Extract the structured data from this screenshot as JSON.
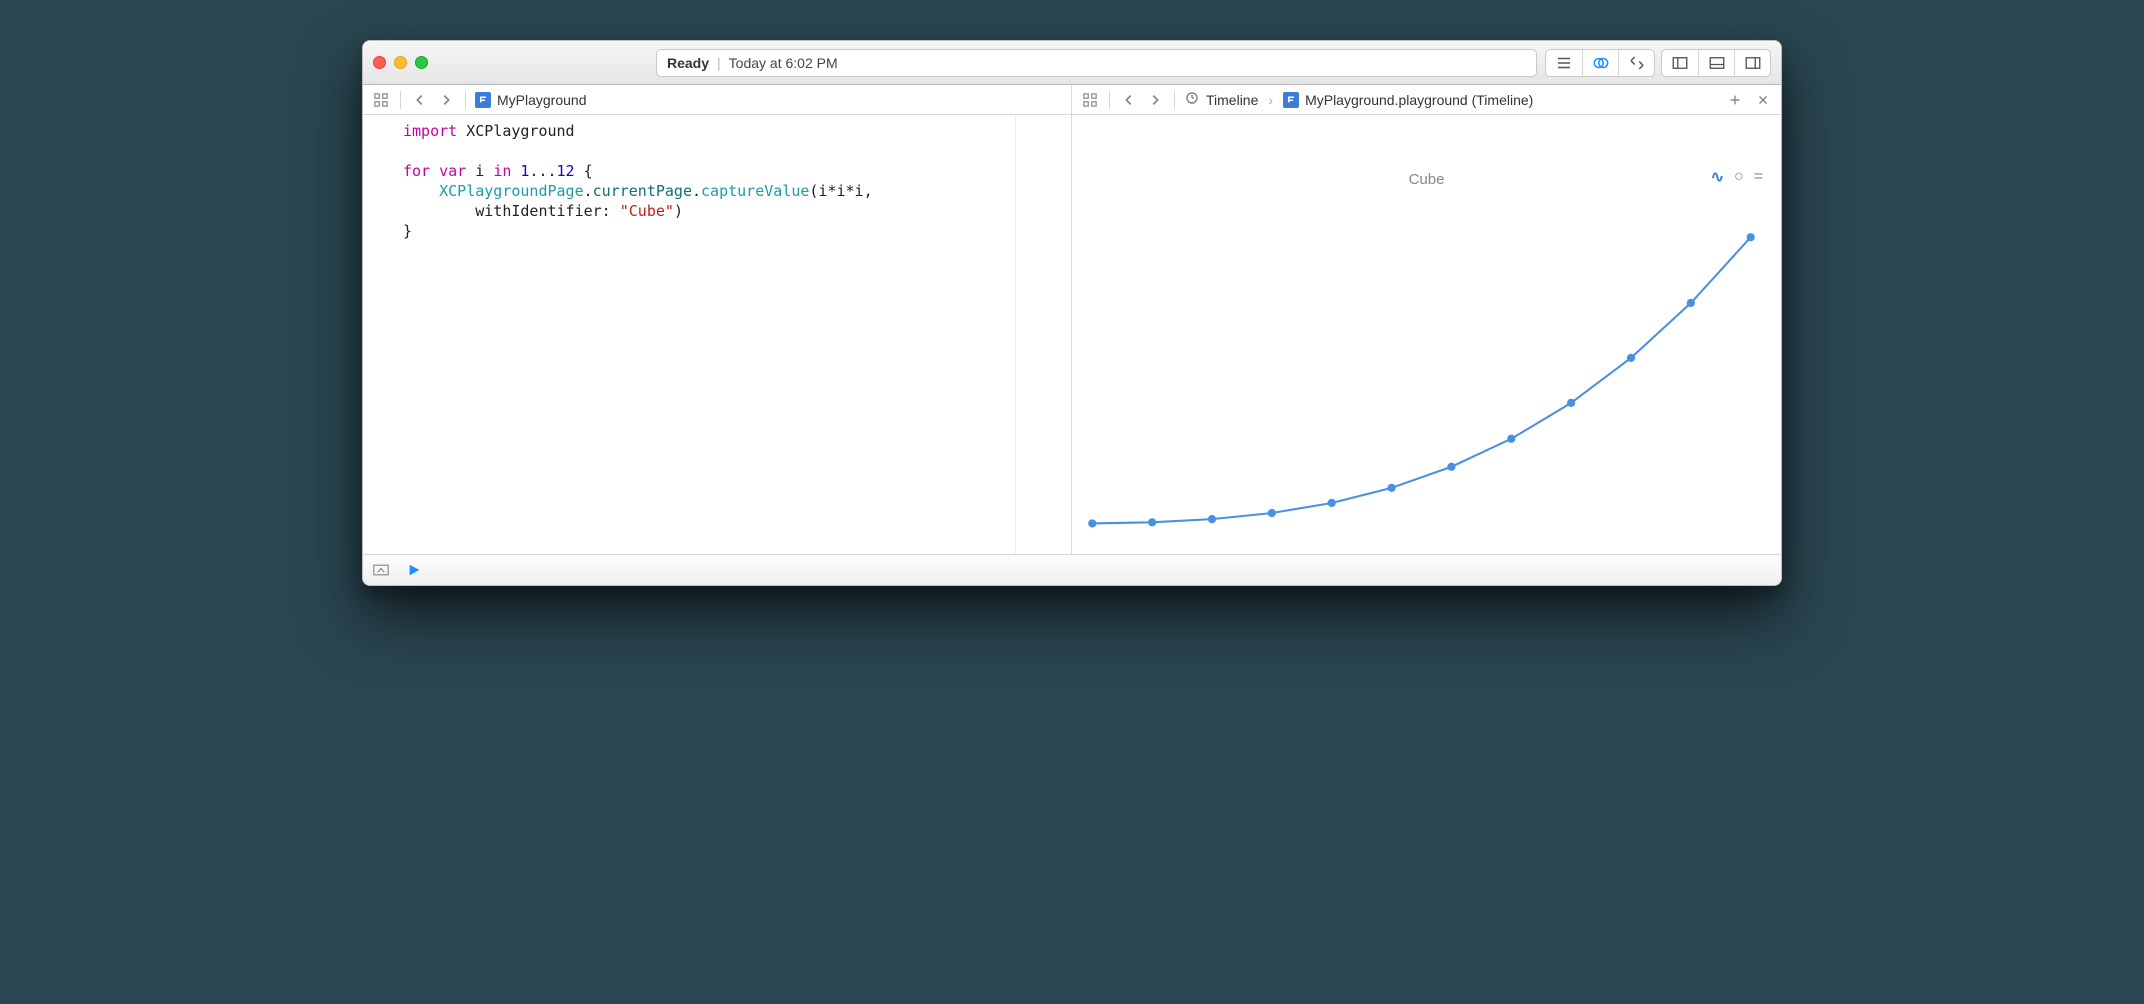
{
  "toolbar": {
    "status_label": "Ready",
    "status_time": "Today at 6:02 PM"
  },
  "left_tab": {
    "filename": "MyPlayground"
  },
  "right_tab": {
    "crumb1": "Timeline",
    "crumb2": "MyPlayground.playground (Timeline)"
  },
  "code": {
    "l1a": "import",
    "l1b": " XCPlayground",
    "l3a": "for",
    "l3b": " ",
    "l3c": "var",
    "l3d": " i ",
    "l3e": "in",
    "l3f": " ",
    "l3g": "1",
    "l3h": "...",
    "l3i": "12",
    "l3j": " {",
    "l4a": "    ",
    "l4b": "XCPlaygroundPage",
    "l4c": ".",
    "l4d": "currentPage",
    "l4e": ".",
    "l4f": "captureValue",
    "l4g": "(i*i*i,",
    "l5a": "        withIdentifier: ",
    "l5b": "\"Cube\"",
    "l5c": ")",
    "l6": "}"
  },
  "chart": {
    "title": "Cube"
  },
  "chart_data": {
    "type": "line",
    "title": "Cube",
    "x": [
      1,
      2,
      3,
      4,
      5,
      6,
      7,
      8,
      9,
      10,
      11,
      12
    ],
    "values": [
      1,
      8,
      27,
      64,
      125,
      216,
      343,
      512,
      729,
      1000,
      1331,
      1728
    ],
    "xlabel": "",
    "ylabel": "",
    "xlim": [
      1,
      12
    ],
    "ylim": [
      0,
      1800
    ]
  }
}
